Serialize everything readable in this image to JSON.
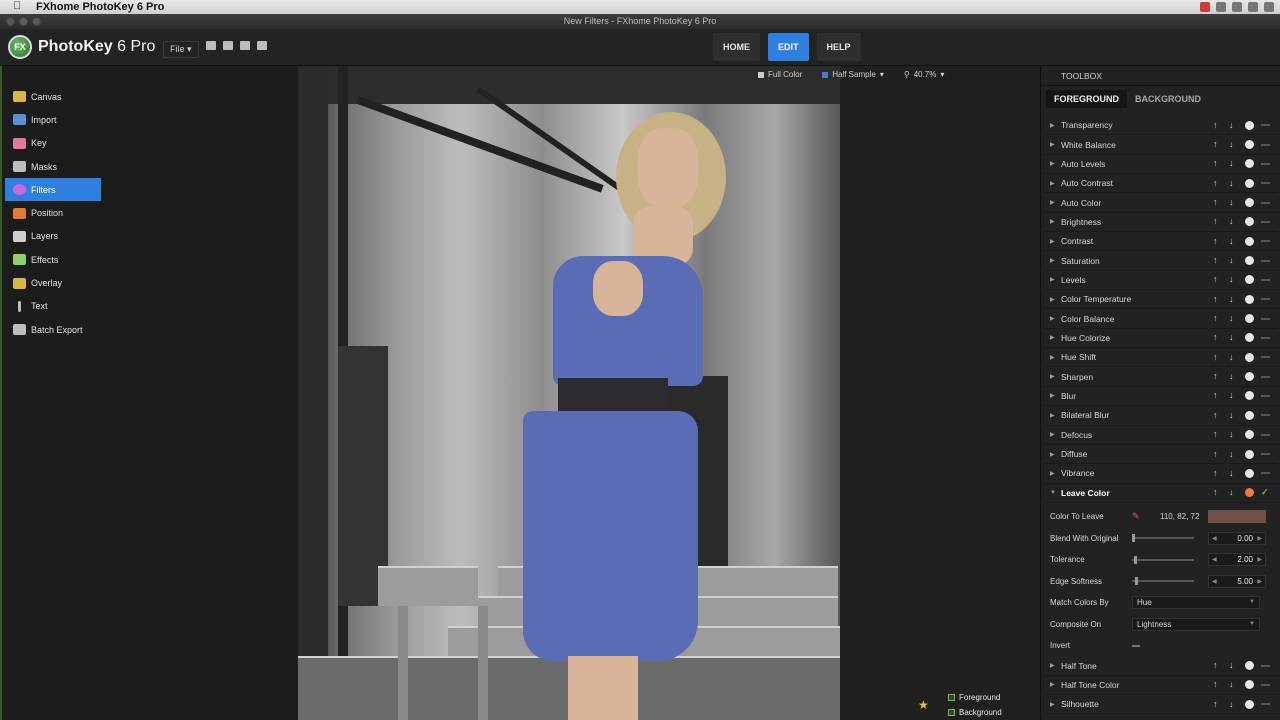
{
  "menubar": {
    "app_name": "FXhome PhotoKey 6 Pro"
  },
  "window": {
    "title": "New Filters - FXhome PhotoKey 6 Pro"
  },
  "header": {
    "logo_text": "PhotoKey",
    "logo_version": "6 Pro",
    "file_menu": "File",
    "nav": [
      "HOME",
      "EDIT",
      "HELP"
    ],
    "active_nav": "EDIT"
  },
  "sidebar": {
    "items": [
      {
        "label": "Canvas",
        "icon": "canvas-icon",
        "color": "#d9b84a"
      },
      {
        "label": "Import",
        "icon": "import-icon",
        "color": "#5b8fd6"
      },
      {
        "label": "Key",
        "icon": "key-icon",
        "color": "#e07a9a"
      },
      {
        "label": "Masks",
        "icon": "masks-icon",
        "color": "#bdbdbd"
      },
      {
        "label": "Filters",
        "icon": "filters-icon",
        "color": "#c86ad8"
      },
      {
        "label": "Position",
        "icon": "position-icon",
        "color": "#e07a3a"
      },
      {
        "label": "Layers",
        "icon": "layers-icon",
        "color": "#cfcfcf"
      },
      {
        "label": "Effects",
        "icon": "effects-icon",
        "color": "#8fd06a"
      },
      {
        "label": "Overlay",
        "icon": "overlay-icon",
        "color": "#d9b84a"
      },
      {
        "label": "Text",
        "icon": "text-icon",
        "color": "#bdbdbd"
      },
      {
        "label": "Batch Export",
        "icon": "batch-export-icon",
        "color": "#bdbdbd"
      }
    ],
    "active": "Filters"
  },
  "canvas": {
    "color_mode": "Full Color",
    "sample_mode": "Half Sample",
    "zoom": "40.7%",
    "layer_toggles": [
      "Foreground",
      "Background"
    ]
  },
  "toolbox": {
    "title": "TOOLBOX",
    "tabs": [
      "FOREGROUND",
      "BACKGROUND"
    ],
    "active_tab": "FOREGROUND",
    "filters_before": [
      "Transparency",
      "White Balance",
      "Auto Levels",
      "Auto Contrast",
      "Auto Color",
      "Brightness",
      "Contrast",
      "Saturation",
      "Levels",
      "Color Temperature",
      "Color Balance",
      "Hue Colorize",
      "Hue Shift",
      "Sharpen",
      "Blur",
      "Bilateral Blur",
      "Defocus",
      "Diffuse",
      "Vibrance"
    ],
    "open_filter": "Leave Color",
    "leave_color": {
      "color_to_leave_label": "Color To Leave",
      "color_to_leave_value": "110, 82, 72",
      "swatch_color": "#6e5248",
      "blend_label": "Blend With Original",
      "blend_value": "0.00",
      "tolerance_label": "Tolerance",
      "tolerance_value": "2.00",
      "edge_label": "Edge Softness",
      "edge_value": "5.00",
      "match_label": "Match Colors By",
      "match_value": "Hue",
      "composite_label": "Composite On",
      "composite_value": "Lightness",
      "invert_label": "Invert"
    },
    "filters_after": [
      "Half Tone",
      "Half Tone Color",
      "Silhouette"
    ]
  }
}
